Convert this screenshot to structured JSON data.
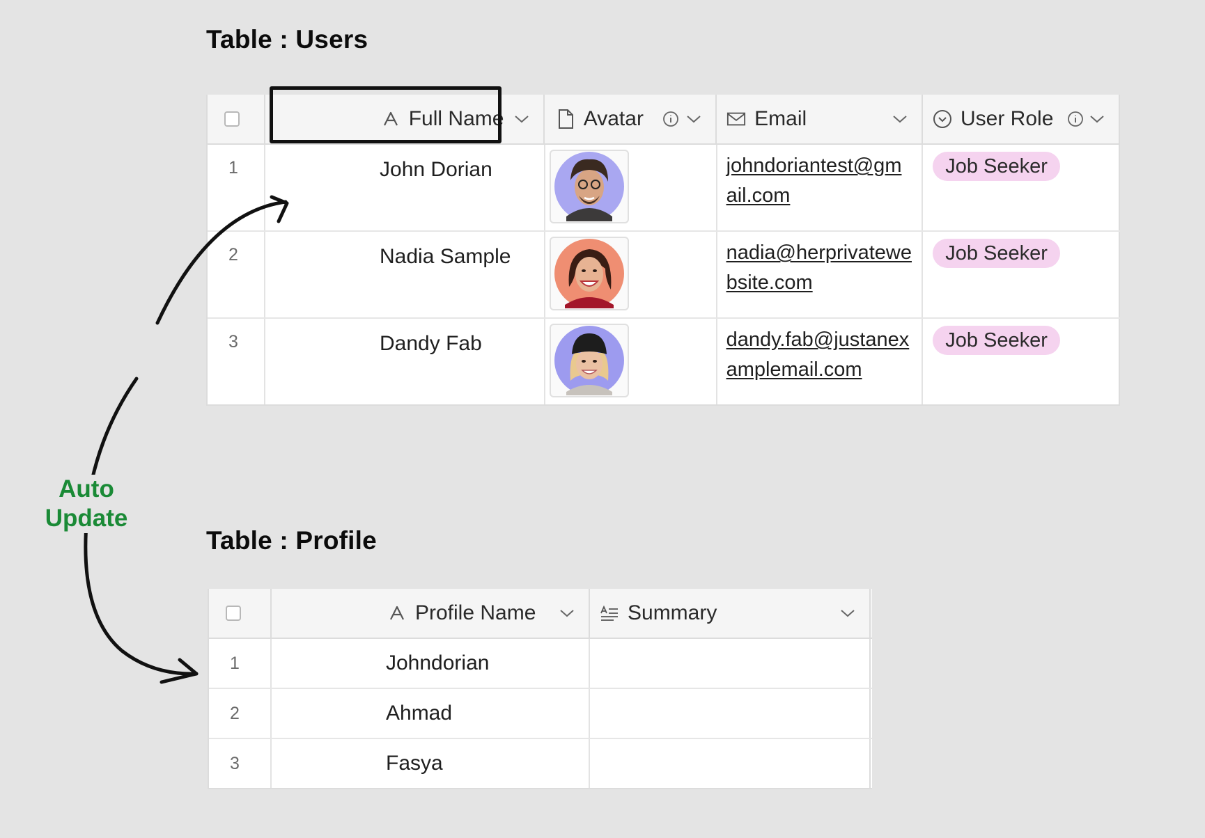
{
  "users_table": {
    "title": "Table : Users",
    "columns": {
      "full_name": "Full Name",
      "avatar": "Avatar",
      "email": "Email",
      "user_role": "User Role"
    },
    "rows": [
      {
        "num": "1",
        "name": "John Dorian",
        "email": "johndoriantest@gmail.com",
        "role": "Job Seeker"
      },
      {
        "num": "2",
        "name": "Nadia Sample",
        "email": "nadia@herprivatewebsite.com",
        "role": "Job Seeker"
      },
      {
        "num": "3",
        "name": "Dandy Fab",
        "email": "dandy.fab@justanexamplemail.com",
        "role": "Job Seeker"
      }
    ]
  },
  "profile_table": {
    "title": "Table : Profile",
    "columns": {
      "profile_name": "Profile Name",
      "summary": "Summary"
    },
    "rows": [
      {
        "num": "1",
        "name": "Johndorian",
        "summary": ""
      },
      {
        "num": "2",
        "name": "Ahmad",
        "summary": ""
      },
      {
        "num": "3",
        "name": "Fasya",
        "summary": ""
      }
    ]
  },
  "annotation": {
    "line1": "Auto",
    "line2": "Update"
  },
  "colors": {
    "badge_bg": "#f5d3ef",
    "annotation_text": "#1a8a36",
    "highlight_border": "#111111"
  }
}
